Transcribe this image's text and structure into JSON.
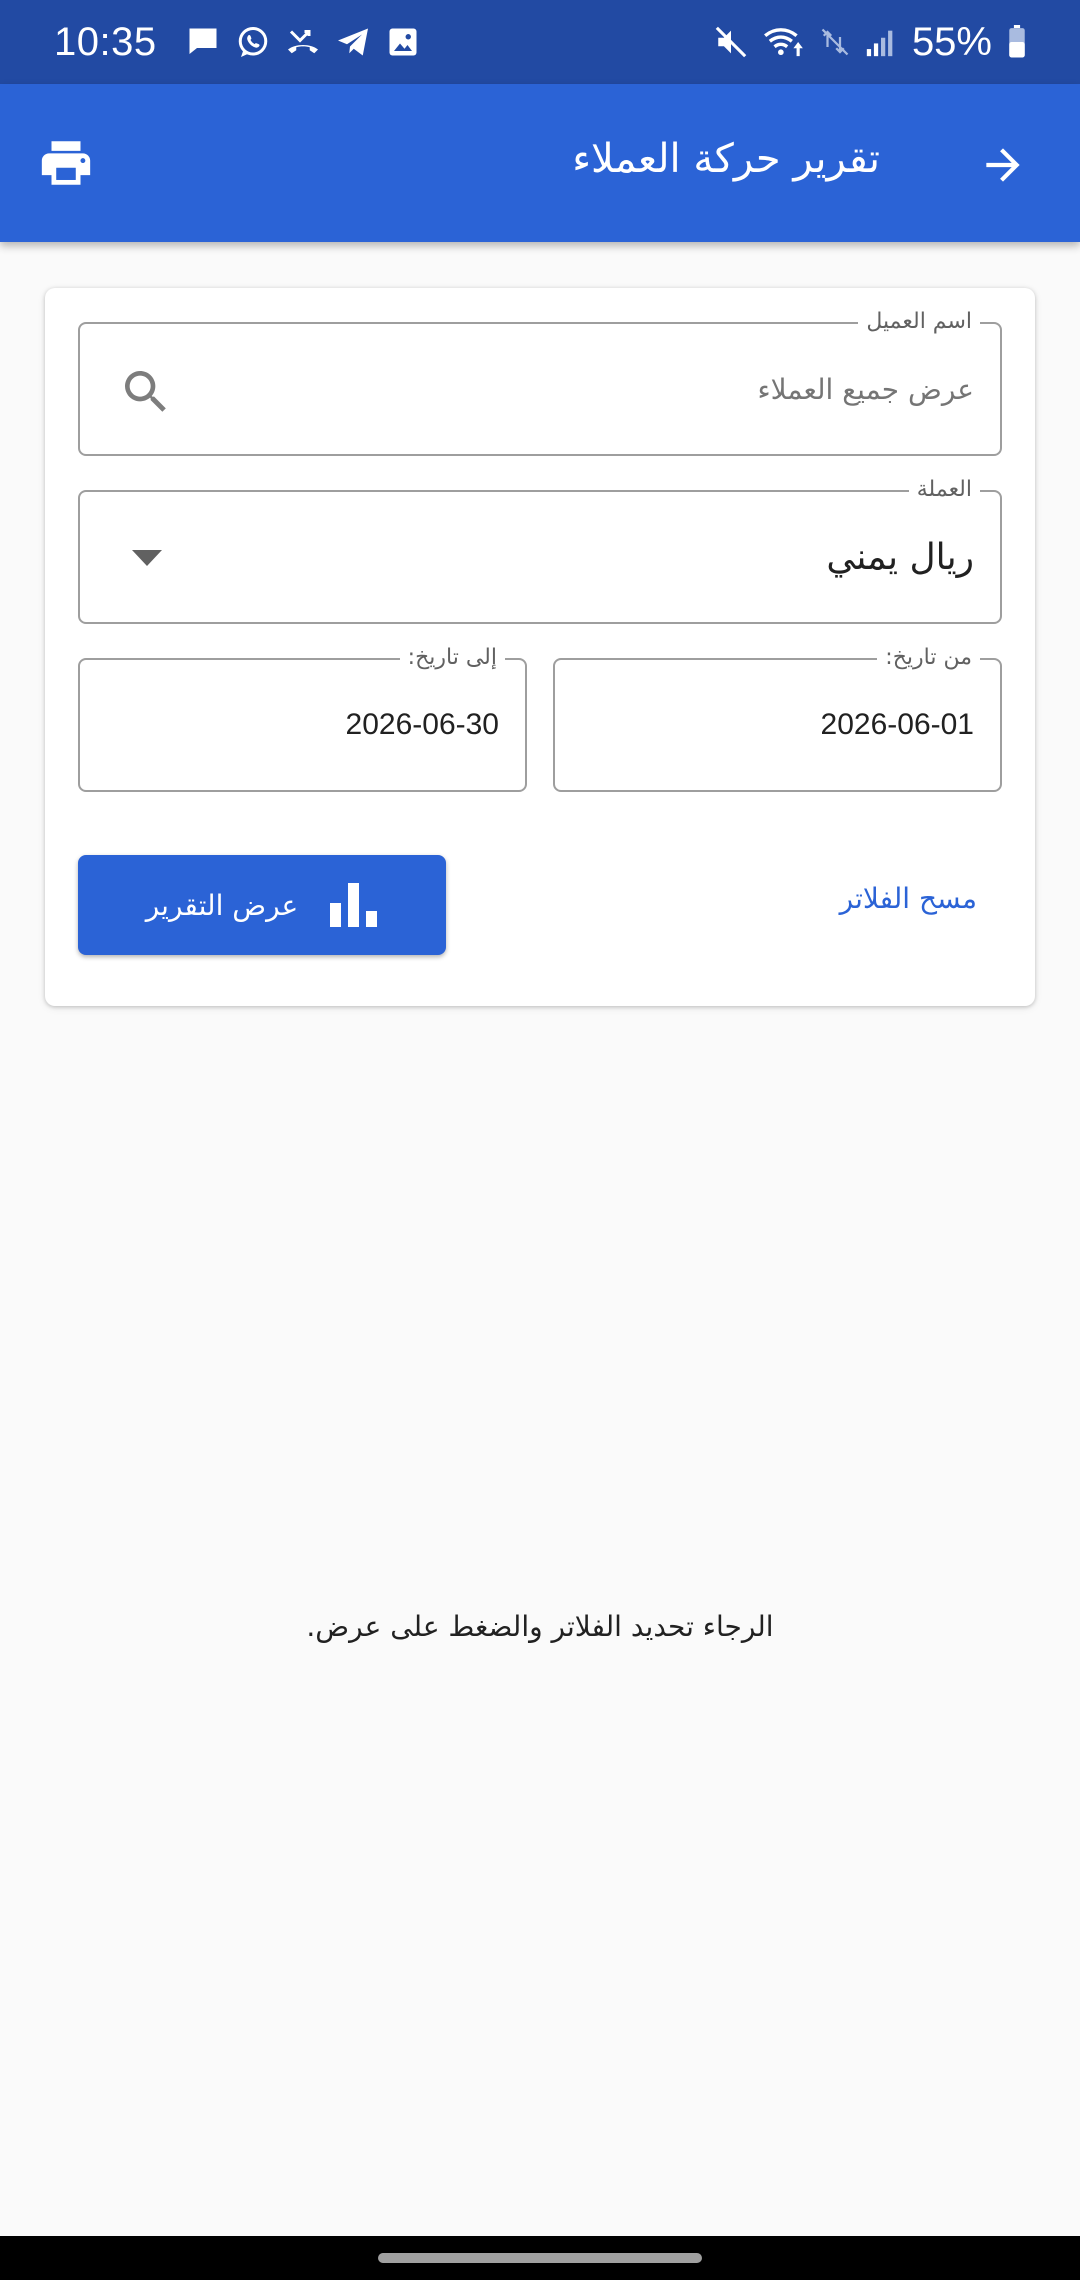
{
  "status_bar": {
    "time": "10:35",
    "notification_icons": [
      "message-icon",
      "whatsapp-icon",
      "missed-call-icon",
      "telegram-icon",
      "gallery-icon"
    ],
    "system_icons": [
      "mute-icon",
      "wifi-icon",
      "data-icon",
      "signal-icon",
      "battery-icon"
    ],
    "battery": "55%"
  },
  "app_bar": {
    "title": "تقرير حركة العملاء",
    "print_icon": "printer-icon",
    "back_icon": "arrow-forward-icon"
  },
  "filters": {
    "customer": {
      "label": "اسم العميل",
      "placeholder": "عرض جميع العملاء",
      "icon": "search-icon"
    },
    "currency": {
      "label": "العملة",
      "value": "ريال يمني",
      "icon": "dropdown-icon"
    },
    "from_date": {
      "label": "من تاريخ:",
      "value": "2026-06-01"
    },
    "to_date": {
      "label": "إلى تاريخ:",
      "value": "2026-06-30"
    },
    "clear_label": "مسح الفلاتر",
    "show_report_label": "عرض التقرير",
    "show_report_icon": "bar-chart-icon"
  },
  "empty_message": "الرجاء تحديد الفلاتر والضغط على عرض.",
  "colors": {
    "status_bar": "#224aa3",
    "primary": "#2b63d6",
    "background": "#fafafa"
  }
}
